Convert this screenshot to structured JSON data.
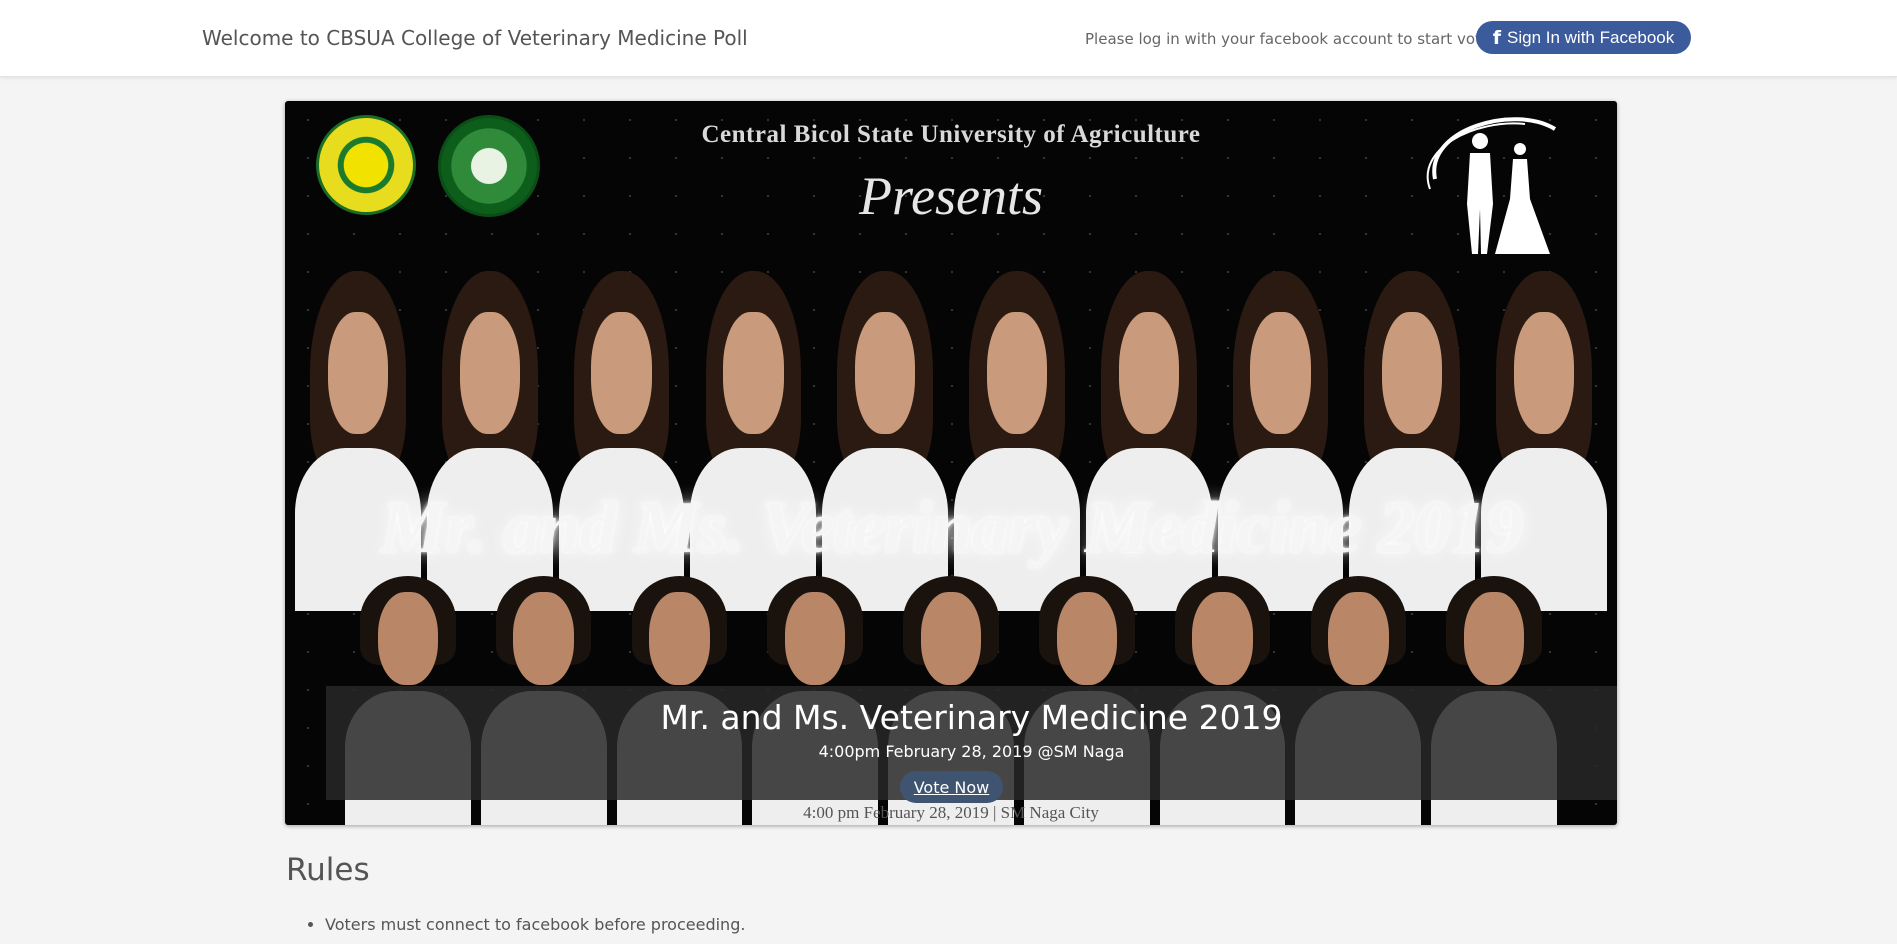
{
  "header": {
    "brand": "Welcome to CBSUA College of Veterinary Medicine Poll",
    "login_hint": "Please log in with your facebook account to start voting.",
    "signin_label": "Sign In with Facebook",
    "signin_icon": "facebook-icon",
    "fb_color": "#3b5b9c"
  },
  "banner": {
    "university": "Central Bicol State University of Agriculture",
    "presents": "Presents",
    "event_title": "Mr. and Ms. Veterinary Medicine 2019",
    "bottom_line": "4:00 pm February 28, 2019 | SM Naga City"
  },
  "caption": {
    "title": "Mr. and Ms. Veterinary Medicine 2019",
    "subtitle": "4:00pm February 28, 2019 @SM Naga",
    "vote_label": "Vote Now"
  },
  "rules": {
    "title": "Rules",
    "items": [
      "Voters must connect to facebook before proceeding."
    ]
  }
}
